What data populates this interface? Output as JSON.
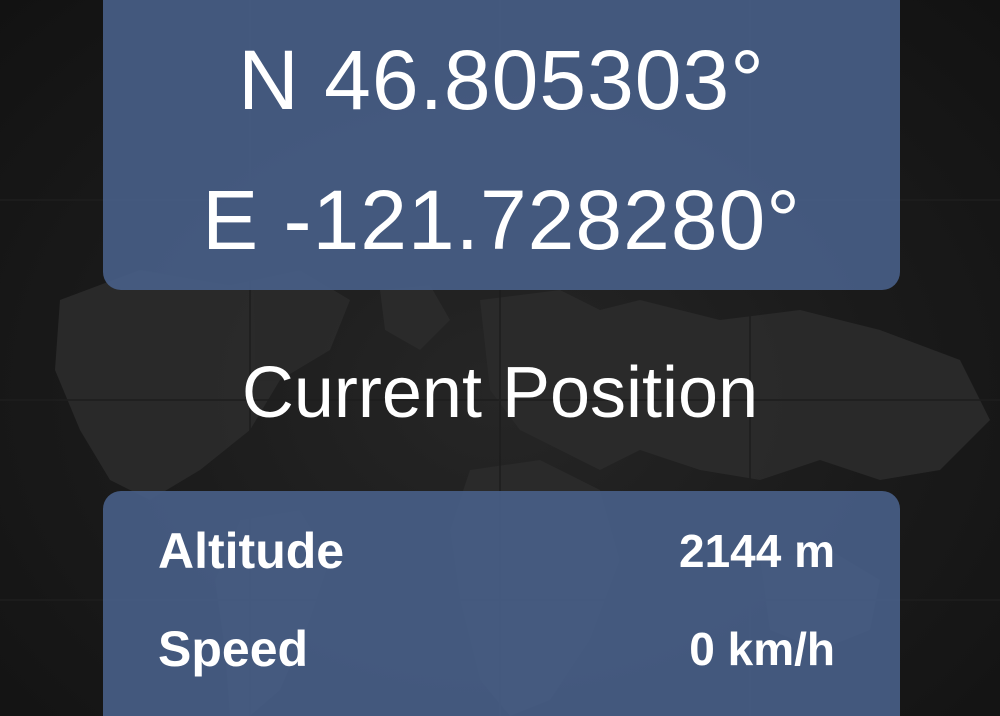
{
  "coordinates": {
    "latitude": "N 46.805303°",
    "longitude": "E -121.728280°"
  },
  "title": "Current Position",
  "stats": {
    "altitude": {
      "label": "Altitude",
      "value": "2144 m"
    },
    "speed": {
      "label": "Speed",
      "value": "0 km/h"
    }
  },
  "colors": {
    "background": "#1a1a1a",
    "map_land": "#2c2c2c",
    "card": "#475e85",
    "text": "#ffffff"
  }
}
